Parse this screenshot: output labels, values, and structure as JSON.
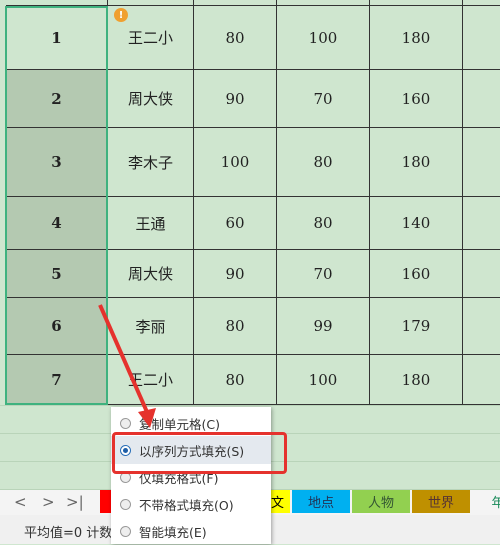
{
  "rows": [
    {
      "n": "1",
      "name": "王二小",
      "a": "80",
      "b": "100",
      "c": "180"
    },
    {
      "n": "2",
      "name": "周大侠",
      "a": "90",
      "b": "70",
      "c": "160"
    },
    {
      "n": "3",
      "name": "李木子",
      "a": "100",
      "b": "80",
      "c": "180"
    },
    {
      "n": "4",
      "name": "王通",
      "a": "60",
      "b": "80",
      "c": "140"
    },
    {
      "n": "5",
      "name": "周大侠",
      "a": "90",
      "b": "70",
      "c": "160"
    },
    {
      "n": "6",
      "name": "李丽",
      "a": "80",
      "b": "99",
      "c": "179"
    },
    {
      "n": "7",
      "name": "王二小",
      "a": "80",
      "b": "100",
      "c": "180"
    }
  ],
  "menu": {
    "items": [
      {
        "label": "复制单元格(C)",
        "selected": false
      },
      {
        "label": "以序列方式填充(S)",
        "selected": true
      },
      {
        "label": "仅填充格式(F)",
        "selected": false
      },
      {
        "label": "不带格式填充(O)",
        "selected": false
      },
      {
        "label": "智能填充(E)",
        "selected": false
      }
    ]
  },
  "sheet_tabs": [
    {
      "label": "",
      "color": "#ff0000"
    },
    {
      "label": "文",
      "color": "#ffff00"
    },
    {
      "label": "地点",
      "color": "#00b0f0"
    },
    {
      "label": "人物",
      "color": "#92d050"
    },
    {
      "label": "世界",
      "color": "#bf9000"
    },
    {
      "label": "年",
      "color": "#ffffff"
    }
  ],
  "nav": {
    "prev": "<",
    "next": ">",
    "last": ">|"
  },
  "status": {
    "text": "平均值=0  计数"
  },
  "colors": {
    "accent": "#3fb27f",
    "highlight": "#e5322d"
  }
}
